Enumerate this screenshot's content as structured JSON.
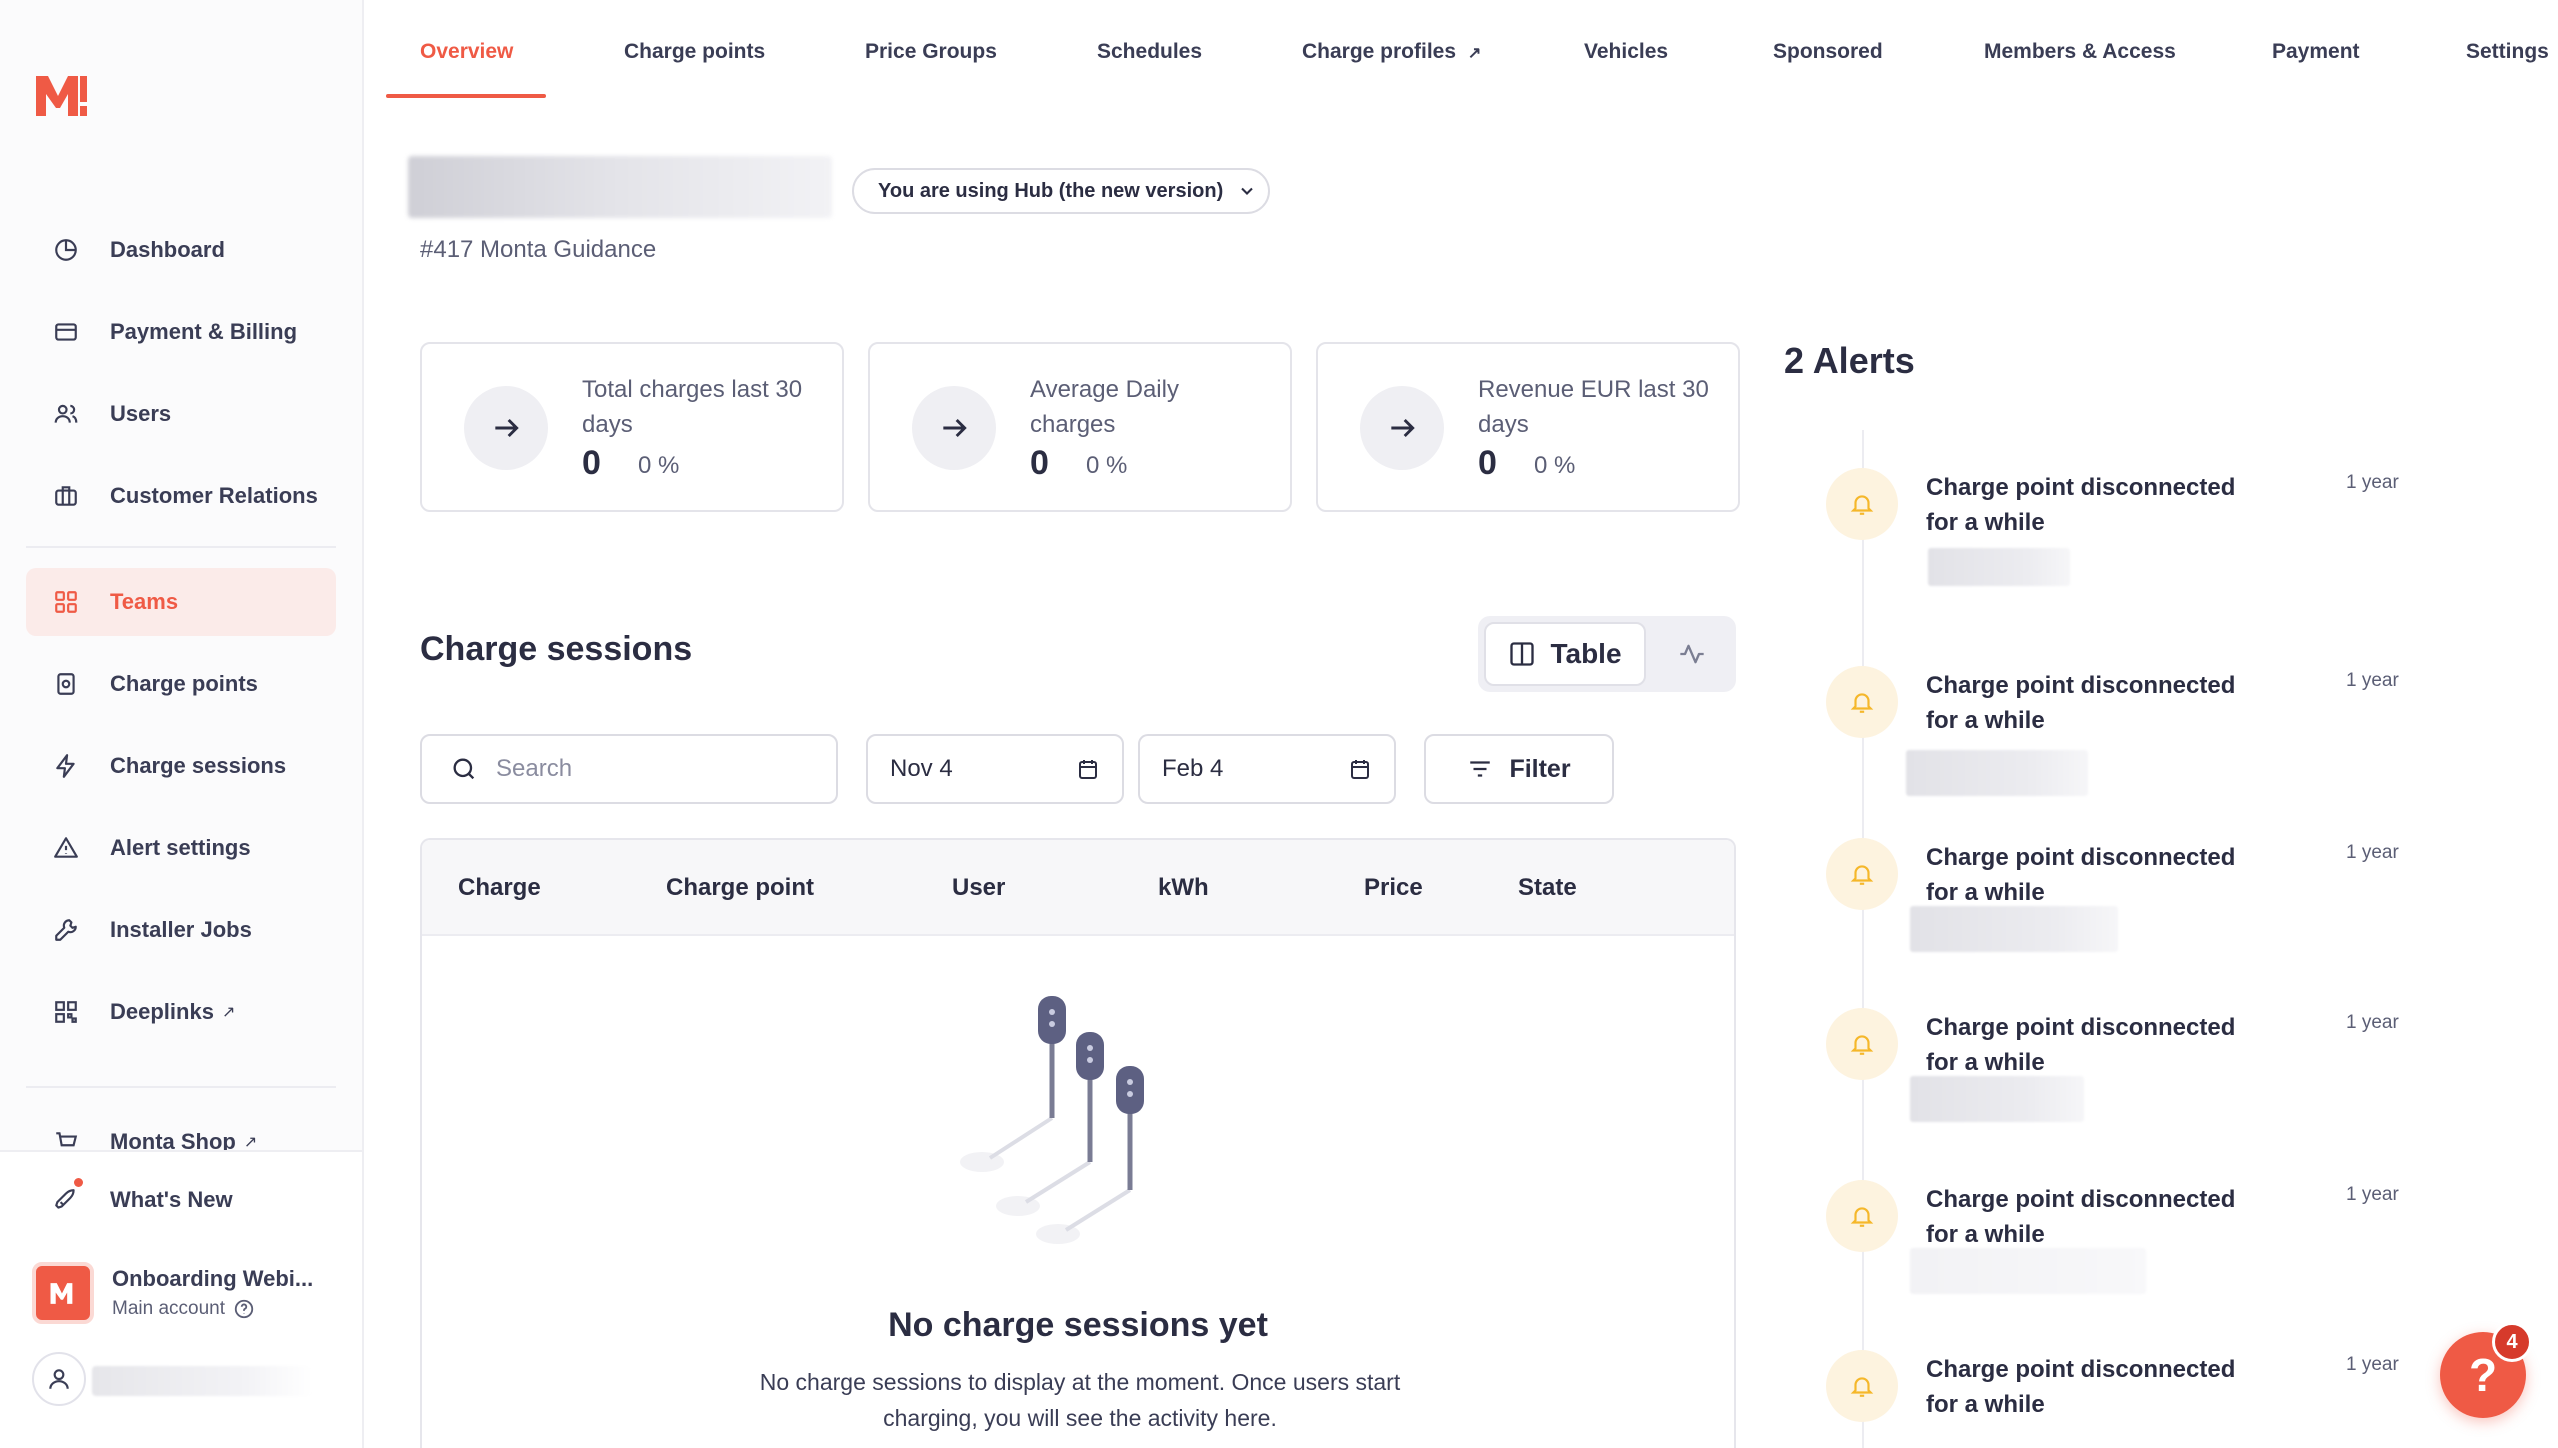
{
  "colors": {
    "accent": "#ef5a45",
    "text": "#2b2d42",
    "muted": "#5b5e75",
    "alert_bg": "#fdf3df",
    "bell": "#f5b72a"
  },
  "sidebar": {
    "items": [
      {
        "label": "Dashboard",
        "icon": "clock-pie-icon"
      },
      {
        "label": "Payment & Billing",
        "icon": "credit-card-icon"
      },
      {
        "label": "Users",
        "icon": "users-icon"
      },
      {
        "label": "Customer Relations",
        "icon": "briefcase-icon"
      },
      {
        "label": "Teams",
        "icon": "grid-icon",
        "active": true
      },
      {
        "label": "Charge points",
        "icon": "charger-icon"
      },
      {
        "label": "Charge sessions",
        "icon": "bolt-icon"
      },
      {
        "label": "Alert settings",
        "icon": "alert-triangle-icon"
      },
      {
        "label": "Installer Jobs",
        "icon": "wrench-icon"
      },
      {
        "label": "Deeplinks",
        "icon": "qr-icon",
        "external": "↗"
      },
      {
        "label": "Monta Shop",
        "icon": "cart-icon",
        "external": "↗"
      }
    ],
    "whats_new": "What's New",
    "account": {
      "name": "Onboarding Webi...",
      "sub": "Main account"
    }
  },
  "tabs": [
    {
      "label": "Overview",
      "active": true
    },
    {
      "label": "Charge points"
    },
    {
      "label": "Price Groups"
    },
    {
      "label": "Schedules"
    },
    {
      "label": "Charge profiles",
      "external": "↗"
    },
    {
      "label": "Vehicles"
    },
    {
      "label": "Sponsored"
    },
    {
      "label": "Members & Access"
    },
    {
      "label": "Payment"
    },
    {
      "label": "Settings"
    }
  ],
  "header": {
    "hub_pill": "You are using Hub (the new version)",
    "subtitle": "#417 Monta Guidance"
  },
  "stats": [
    {
      "label": "Total charges last 30 days",
      "value": "0",
      "pct": "0 %"
    },
    {
      "label": "Average Daily charges",
      "value": "0",
      "pct": "0 %"
    },
    {
      "label": "Revenue EUR last 30 days",
      "value": "0",
      "pct": "0 %"
    }
  ],
  "sessions": {
    "title": "Charge sessions",
    "view_table": "Table",
    "search_placeholder": "Search",
    "date_from": "Nov 4",
    "date_to": "Feb 4",
    "filter": "Filter",
    "columns": [
      "Charge",
      "Charge point",
      "User",
      "kWh",
      "Price",
      "State"
    ],
    "empty_title": "No charge sessions yet",
    "empty_text": "No charge sessions to display at the moment. Once users start charging, you will see the activity here."
  },
  "alerts": {
    "title": "2 Alerts",
    "items": [
      {
        "text": "Charge point disconnected for a while",
        "time": "1 year"
      },
      {
        "text": "Charge point disconnected for a while",
        "time": "1 year"
      },
      {
        "text": "Charge point disconnected for a while",
        "time": "1 year"
      },
      {
        "text": "Charge point disconnected for a while",
        "time": "1 year"
      },
      {
        "text": "Charge point disconnected for a while",
        "time": "1 year"
      },
      {
        "text": "Charge point disconnected for a while",
        "time": "1 year"
      }
    ]
  },
  "help": {
    "label": "?",
    "badge": "4"
  }
}
